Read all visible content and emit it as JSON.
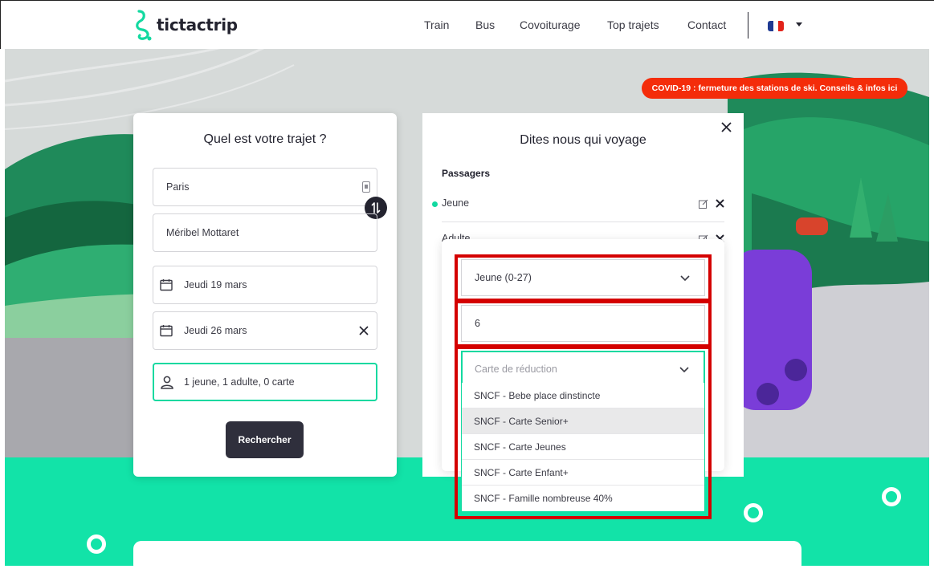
{
  "header": {
    "logo_text": "tictactrip",
    "nav": [
      "Train",
      "Bus",
      "Covoiturage",
      "Top trajets",
      "Contact"
    ],
    "language_flag": "fr-flag-icon"
  },
  "banner": {
    "covid_text": "COVID-19 : fermeture des stations de ski. Conseils & infos ici",
    "color": "#f42c0a"
  },
  "search_form": {
    "title": "Quel est votre trajet ?",
    "origin": "Paris",
    "destination": "Méribel Mottaret",
    "departure_date": "Jeudi 19 mars",
    "return_date": "Jeudi 26 mars",
    "passengers_summary": "1 jeune, 1 adulte, 0 carte",
    "search_label": "Rechercher"
  },
  "passengers_panel": {
    "title": "Dites nous qui voyage",
    "section_label": "Passagers",
    "passengers": [
      "Jeune",
      "Adulte"
    ],
    "age_select": "Jeune (0-27)",
    "age_input": "6",
    "discount_placeholder": "Carte de réduction",
    "discount_options": [
      "SNCF - Bebe place dinstincte",
      "SNCF - Carte Senior+",
      "SNCF - Carte Jeunes",
      "SNCF - Carte Enfant+",
      "SNCF - Famille nombreuse 40%"
    ],
    "highlighted_option_index": 1
  },
  "colors": {
    "accent": "#12e3a8",
    "dark": "#23232f",
    "annotation_red": "#d40000"
  }
}
